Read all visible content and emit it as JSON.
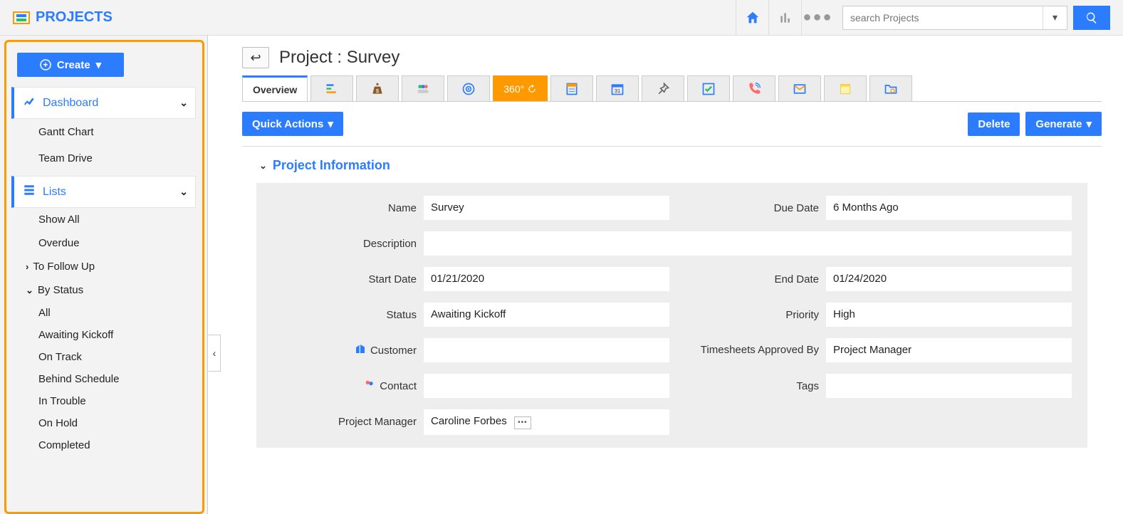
{
  "brand": "PROJECTS",
  "search": {
    "placeholder": "search Projects"
  },
  "sidebar": {
    "create": "Create",
    "dashboard": "Dashboard",
    "dashboard_items": [
      "Gantt Chart",
      "Team Drive"
    ],
    "lists": "Lists",
    "lists_items": [
      "Show All",
      "Overdue"
    ],
    "tofollowup": "To Follow Up",
    "bystatus": "By Status",
    "status_items": [
      "All",
      "Awaiting Kickoff",
      "On Track",
      "Behind Schedule",
      "In Trouble",
      "On Hold",
      "Completed"
    ]
  },
  "page": {
    "title": "Project : Survey"
  },
  "tabs": {
    "overview": "Overview",
    "tab360": "360°"
  },
  "actions": {
    "quick": "Quick Actions",
    "delete": "Delete",
    "generate": "Generate"
  },
  "section": {
    "project_info": "Project Information"
  },
  "labels": {
    "name": "Name",
    "due_date": "Due Date",
    "description": "Description",
    "start_date": "Start Date",
    "end_date": "End Date",
    "status": "Status",
    "priority": "Priority",
    "customer": "Customer",
    "timesheets": "Timesheets Approved By",
    "contact": "Contact",
    "tags": "Tags",
    "pm": "Project Manager"
  },
  "values": {
    "name": "Survey",
    "due_date": "6 Months Ago",
    "description": "",
    "start_date": "01/21/2020",
    "end_date": "01/24/2020",
    "status": "Awaiting Kickoff",
    "priority": "High",
    "customer": "",
    "timesheets": "Project Manager",
    "contact": "",
    "tags": "",
    "pm": "Caroline Forbes"
  }
}
